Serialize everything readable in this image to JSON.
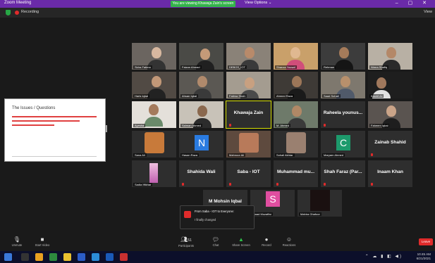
{
  "titlebar": {
    "app": "Zoom Meeting",
    "share_label": "You are viewing Khawaja Zain's screen",
    "view_options": "View Options ⌄",
    "window_controls": "–  ▢  ✕"
  },
  "subbar": {
    "recording": "Recording",
    "view": "View"
  },
  "slide": {
    "title": "The Issues / Questions"
  },
  "participants": {
    "row1": [
      "Sidra Fatima",
      "Faizan Ahmad",
      "DEBOS_IOT",
      "Shanza Yousaf",
      "Rehman",
      "Nimra Shafiq"
    ],
    "row2": [
      "Haris Iqbal",
      "Ahsan Iqbal",
      "Fatima Shah",
      "Ahmed Raza",
      "Saad Sohail",
      "Kashif Ali"
    ],
    "row3_left": [
      "Ayesha",
      "Salman Ahmed"
    ],
    "active_speaker": "Khawaja Zain",
    "row3_right_label": "M. Ahmed",
    "rahoola": "Raheela younus...",
    "row3_last": "Faheem Iqbal",
    "row4": [
      "Sana Ali",
      "Hasan Raza",
      "Mahnoor Ali",
      "Sohail Akhtar",
      "Maryam Ahmed"
    ],
    "row4_initial_n": "N",
    "row4_initial_c": "C",
    "zainab": "Zainab Shahid",
    "row5": [
      "Shahida Wali",
      "Saba - IOT",
      "Muhammad mu...",
      "Shah Faraz (Par...",
      "Inaam Khan"
    ],
    "row5_first": "Sadia Iftikhar",
    "row6": [
      "M Mohsin Iqbal",
      "Saad Muzaffar",
      "Mahira Ghafoor"
    ],
    "initial_s": "S"
  },
  "chat_popup": {
    "from": "From Saba - IOT to Everyone:",
    "message": "I finally changed"
  },
  "toolbar": {
    "unmute": "Unmute",
    "start_video": "Start Video",
    "participants_count": "51",
    "participants": "Participants",
    "chat": "Chat",
    "share_screen": "Share Screen",
    "record": "Record",
    "reactions": "Reactions",
    "leave": "Leave"
  },
  "taskbar": {
    "time": "10:45 AM",
    "date": "6/21/2021"
  },
  "colors": {
    "titlebar": "#6a2aa8",
    "share_banner": "#34b44a",
    "active_border": "#d7e000",
    "leave": "#e02b2b"
  }
}
